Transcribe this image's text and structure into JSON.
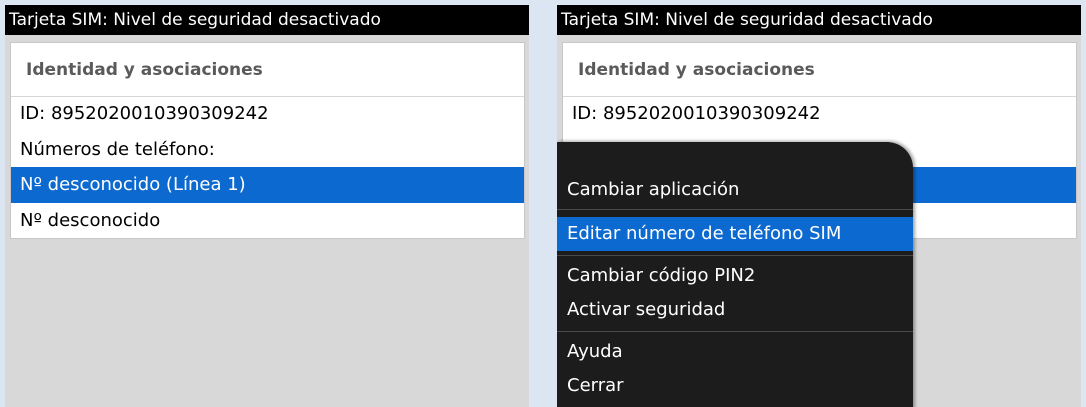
{
  "left_screen": {
    "title": "Tarjeta SIM: Nivel de seguridad desactivado",
    "header": "Identidad y asociaciones",
    "rows": [
      "ID: 8952020010390309242",
      "Números de teléfono:",
      "Nº desconocido (Línea 1)",
      "Nº desconocido"
    ],
    "selected_index": 2
  },
  "right_screen": {
    "title": "Tarjeta SIM: Nivel de seguridad desactivado",
    "header": "Identidad y asociaciones",
    "rows": [
      "ID: 8952020010390309242"
    ],
    "menu": {
      "items": [
        "Cambiar aplicación",
        "Editar número de teléfono SIM",
        "Cambiar código PIN2",
        "Activar seguridad",
        "Ayuda",
        "Cerrar"
      ],
      "selected_index": 1
    }
  },
  "colors": {
    "selection": "#0c69d0",
    "title_bar": "#000000",
    "menu_bg": "#1c1c1c",
    "page_bg": "#dbe6f2"
  }
}
